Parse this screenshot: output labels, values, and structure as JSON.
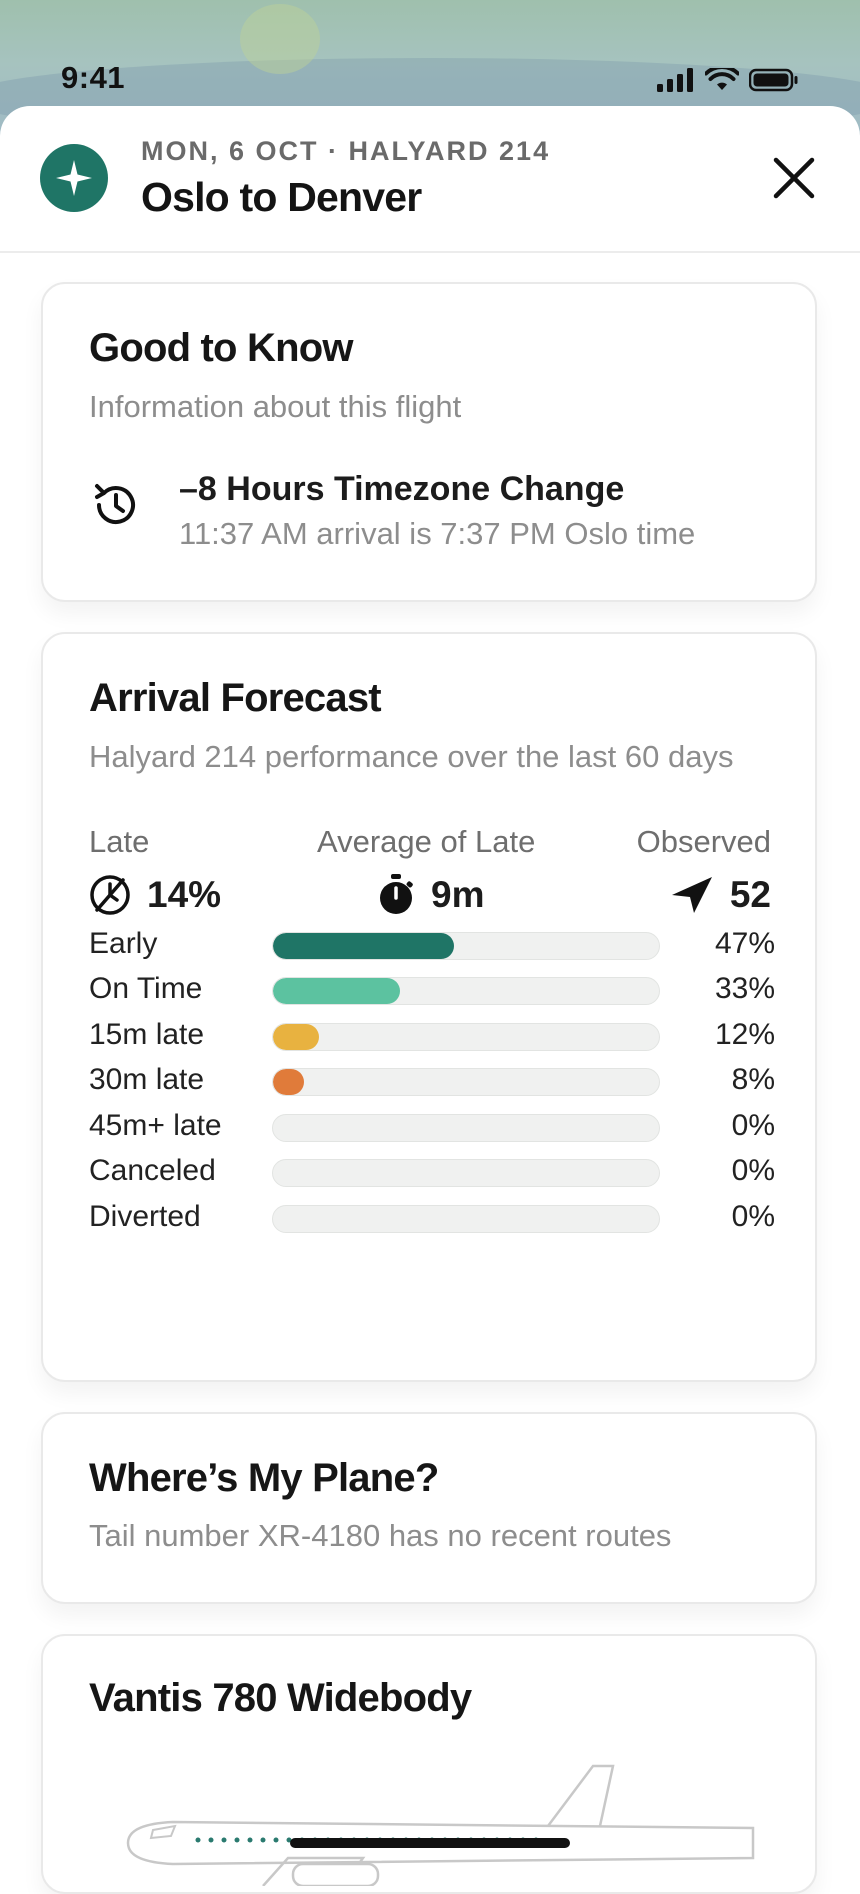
{
  "status_bar": {
    "time": "9:41"
  },
  "header": {
    "subtitle": "MON, 6 OCT · HALYARD 214",
    "title": "Oslo to Denver"
  },
  "good_to_know": {
    "title": "Good to Know",
    "subtitle": "Information about this flight",
    "timezone_title": "–8 Hours Timezone Change",
    "timezone_desc": "11:37 AM arrival is 7:37 PM Oslo time"
  },
  "forecast": {
    "title": "Arrival Forecast",
    "subtitle": "Halyard 214 performance over the last 60 days",
    "stats": [
      {
        "label": "Late",
        "value": "14%",
        "icon": "late-clock-icon"
      },
      {
        "label": "Average of Late",
        "value": "9m",
        "icon": "stopwatch-icon"
      },
      {
        "label": "Observed",
        "value": "52",
        "icon": "plane-icon"
      }
    ],
    "rows": [
      {
        "label": "Early",
        "pct": "47%",
        "fraction": 0.47,
        "color": "#1f7566"
      },
      {
        "label": "On Time",
        "pct": "33%",
        "fraction": 0.33,
        "color": "#5cc2a0"
      },
      {
        "label": "15m late",
        "pct": "12%",
        "fraction": 0.12,
        "color": "#e8b240"
      },
      {
        "label": "30m late",
        "pct": "8%",
        "fraction": 0.08,
        "color": "#e07b3a"
      },
      {
        "label": "45m+ late",
        "pct": "0%",
        "fraction": 0,
        "color": "#e07b3a"
      },
      {
        "label": "Canceled",
        "pct": "0%",
        "fraction": 0,
        "color": "#e07b3a"
      },
      {
        "label": "Diverted",
        "pct": "0%",
        "fraction": 0,
        "color": "#e07b3a"
      }
    ]
  },
  "where_plane": {
    "title": "Where’s My Plane?",
    "subtitle": "Tail number XR-4180 has no recent routes"
  },
  "aircraft": {
    "title": "Vantis 780 Widebody"
  },
  "colors": {
    "brand": "#1f7566",
    "on_time": "#5cc2a0",
    "late_15": "#e8b240",
    "late_30": "#e07b3a"
  }
}
